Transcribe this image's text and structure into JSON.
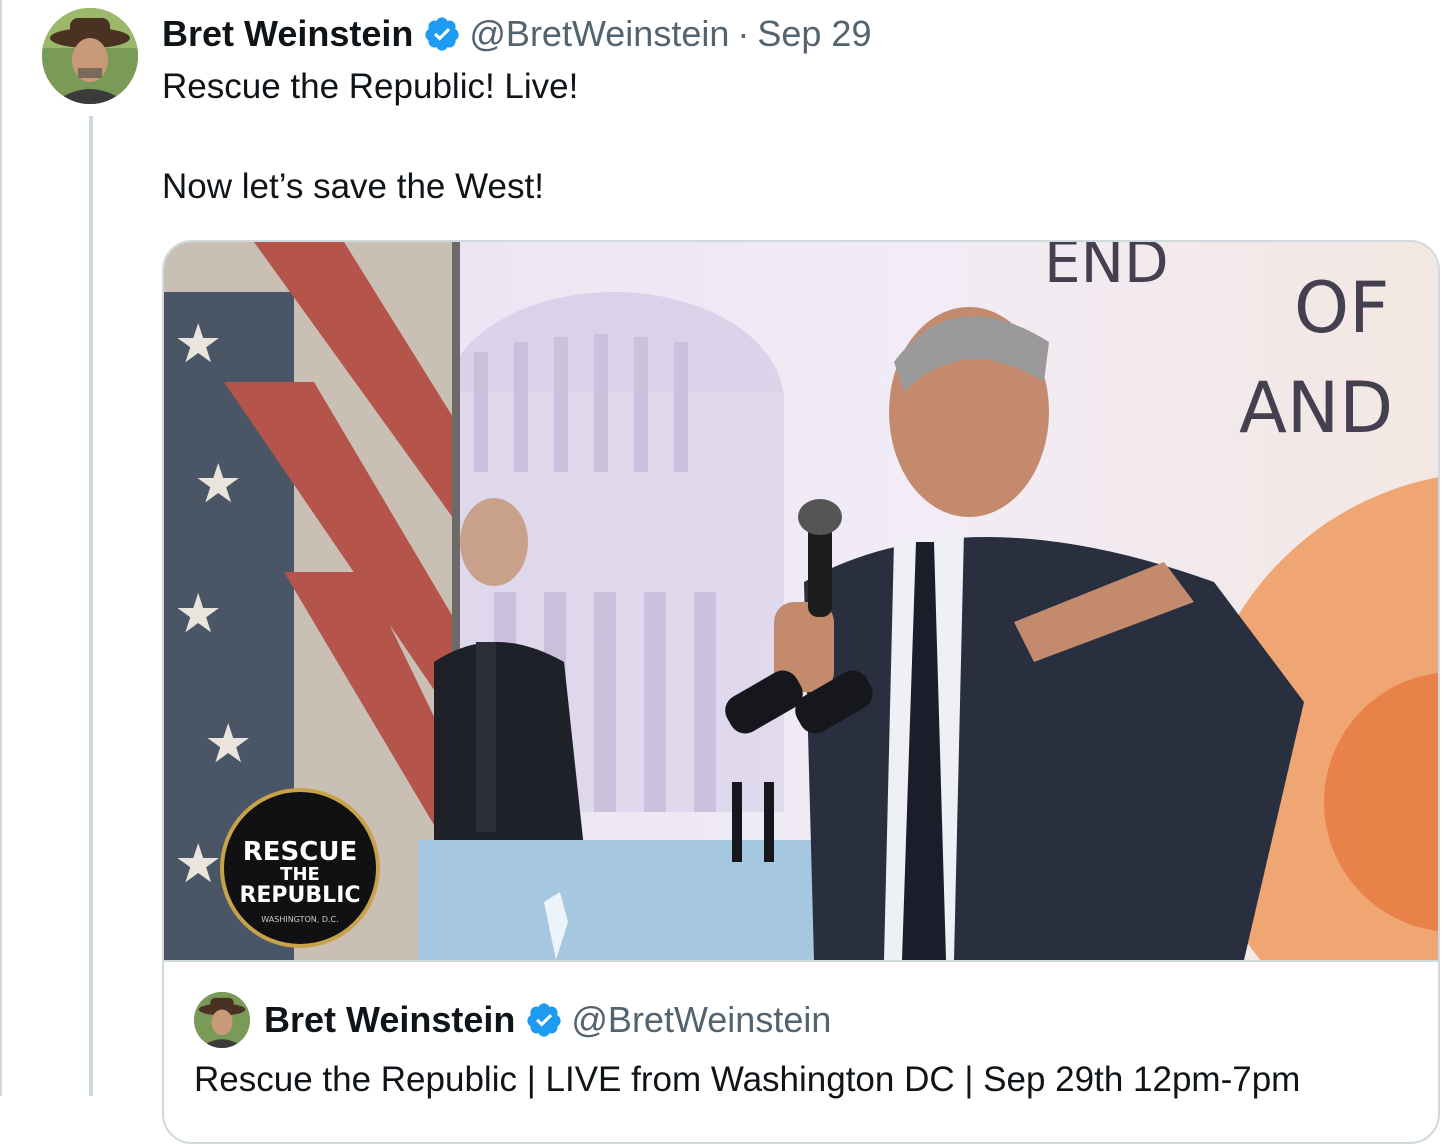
{
  "tweet": {
    "author_name": "Bret Weinstein",
    "handle": "@BretWeinstein",
    "separator": "·",
    "date": "Sep 29",
    "text": "Rescue the Republic! Live!\n\nNow let’s save the West!"
  },
  "video": {
    "backdrop_text_1": "END",
    "backdrop_text_2": "OF",
    "backdrop_text_3": "AND",
    "logo_line_1": "RESCUE",
    "logo_line_2": "THE",
    "logo_line_3": "REPUBLIC",
    "logo_line_4": "WASHINGTON, D.C."
  },
  "quoted_tweet": {
    "author_name": "Bret Weinstein",
    "handle": "@BretWeinstein",
    "text": "Rescue the Republic | LIVE from Washington DC | Sep 29th 12pm-7pm"
  },
  "colors": {
    "verified_blue": "#1d9bf0",
    "secondary_text": "#536471",
    "border": "#cfd9de"
  }
}
